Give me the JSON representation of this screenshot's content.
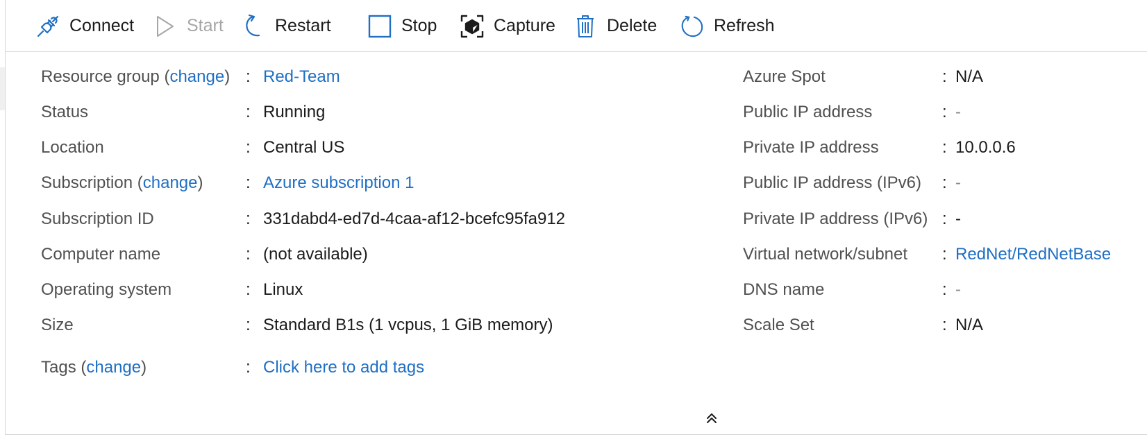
{
  "toolbar": {
    "connect": "Connect",
    "start": "Start",
    "restart": "Restart",
    "stop": "Stop",
    "capture": "Capture",
    "delete": "Delete",
    "refresh": "Refresh"
  },
  "essentials": {
    "left": {
      "resource_group": {
        "label": "Resource group",
        "change": "change",
        "value": "Red-Team"
      },
      "status": {
        "label": "Status",
        "value": "Running"
      },
      "location": {
        "label": "Location",
        "value": "Central US"
      },
      "subscription": {
        "label": "Subscription",
        "change": "change",
        "value": "Azure subscription 1"
      },
      "subscription_id": {
        "label": "Subscription ID",
        "value": "331dabd4-ed7d-4caa-af12-bcefc95fa912"
      },
      "computer_name": {
        "label": "Computer name",
        "value": "(not available)"
      },
      "operating_system": {
        "label": "Operating system",
        "value": "Linux"
      },
      "size": {
        "label": "Size",
        "value": "Standard B1s (1 vcpus, 1 GiB memory)"
      },
      "tags": {
        "label": "Tags",
        "change": "change",
        "value": "Click here to add tags"
      }
    },
    "right": {
      "azure_spot": {
        "label": "Azure Spot",
        "value": "N/A"
      },
      "public_ip": {
        "label": "Public IP address",
        "value": "-"
      },
      "private_ip": {
        "label": "Private IP address",
        "value": "10.0.0.6"
      },
      "public_ipv6": {
        "label": "Public IP address (IPv6)",
        "value": "-"
      },
      "private_ipv6": {
        "label": "Private IP address (IPv6)",
        "value": "-"
      },
      "vnet_subnet": {
        "label": "Virtual network/subnet",
        "value": "RedNet/RedNetBase"
      },
      "dns_name": {
        "label": "DNS name",
        "value": "-"
      },
      "scale_set": {
        "label": "Scale Set",
        "value": "N/A"
      }
    },
    "colon": ":",
    "paren_open": "(",
    "paren_close": ")"
  },
  "icons": {
    "connect": "plug-icon",
    "start": "play-icon",
    "restart": "restart-icon",
    "stop": "stop-icon",
    "capture": "capture-icon",
    "delete": "trash-icon",
    "refresh": "refresh-icon",
    "collapse": "double-chevron-up-icon"
  },
  "colors": {
    "accent": "#1f6fc4",
    "label": "#505050",
    "text": "#1b1b1b",
    "disabled": "#a6a6a6"
  }
}
